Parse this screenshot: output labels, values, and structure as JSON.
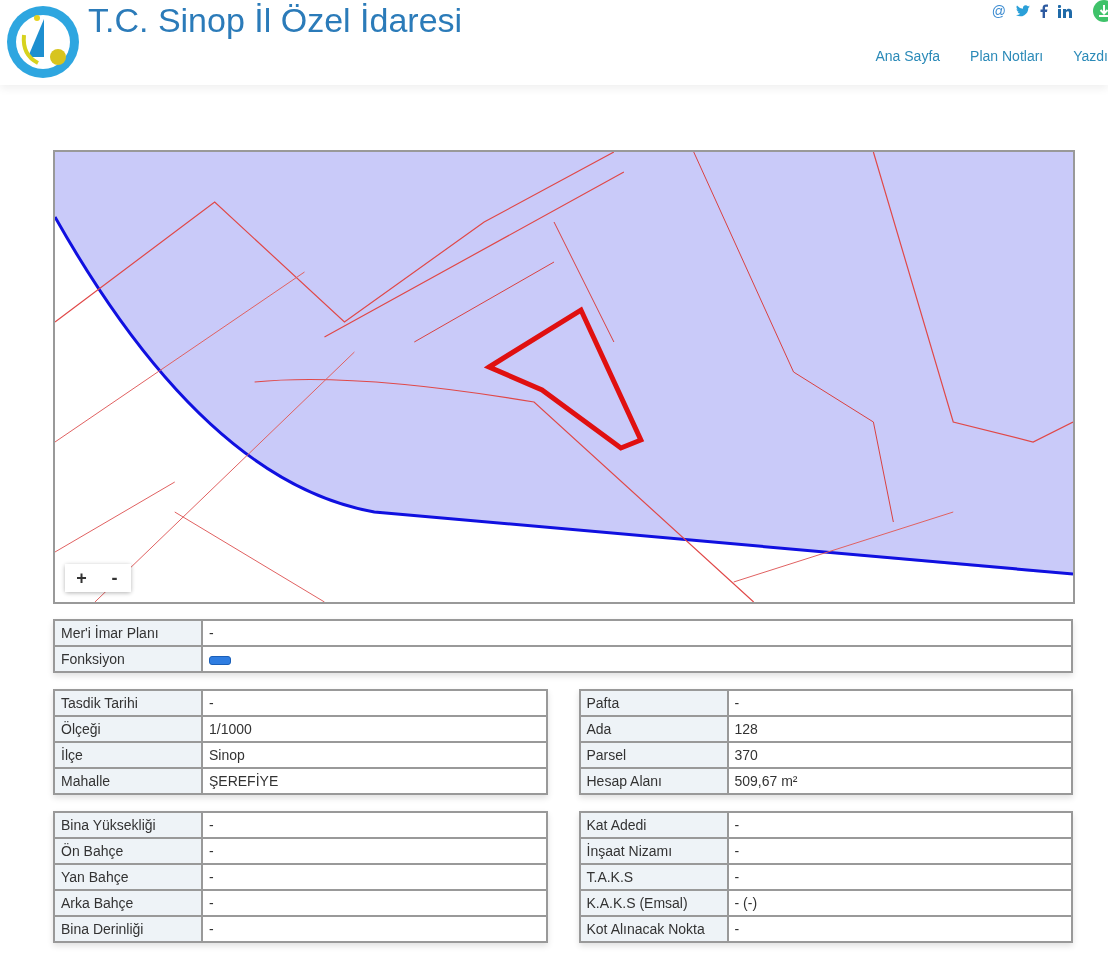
{
  "header": {
    "title": "T.C. Sinop İl Özel İdaresi",
    "social": [
      "@"
    ],
    "nav": [
      "Ana Sayfa",
      "Plan Notları",
      "Yazdı"
    ]
  },
  "map": {
    "kind": "picture",
    "zoom_buttons": [
      "+",
      "-"
    ]
  },
  "plan_table": [
    {
      "label": "Mer'i İmar Planı",
      "kind": "text",
      "value": "-"
    },
    {
      "label": "Fonksiyon",
      "kind": "swatch",
      "color": "#2f7de1"
    }
  ],
  "left_tables": [
    [
      {
        "label": "Tasdik Tarihi",
        "value": "-"
      },
      {
        "label": "Ölçeği",
        "value": "1/1000"
      },
      {
        "label": "İlçe",
        "value": "Sinop"
      },
      {
        "label": "Mahalle",
        "value": "ŞEREFİYE"
      }
    ],
    [
      {
        "label": "Bina Yüksekliği",
        "value": "-"
      },
      {
        "label": "Ön Bahçe",
        "value": "-"
      },
      {
        "label": "Yan Bahçe",
        "value": "-"
      },
      {
        "label": "Arka Bahçe",
        "value": "-"
      },
      {
        "label": "Bina Derinliği",
        "value": "-"
      }
    ]
  ],
  "right_tables": [
    [
      {
        "label": "Pafta",
        "value": "-"
      },
      {
        "label": "Ada",
        "value": "128"
      },
      {
        "label": "Parsel",
        "value": "370"
      },
      {
        "label": "Hesap Alanı",
        "value": "509,67 m²"
      }
    ],
    [
      {
        "label": "Kat Adedi",
        "value": "-"
      },
      {
        "label": "İnşaat Nizamı",
        "value": "-"
      },
      {
        "label": "T.A.K.S",
        "value": "-"
      },
      {
        "label": "K.A.K.S (Emsal)",
        "value": "- (-)"
      },
      {
        "label": "Kot Alınacak Nokta",
        "value": "-"
      }
    ]
  ]
}
